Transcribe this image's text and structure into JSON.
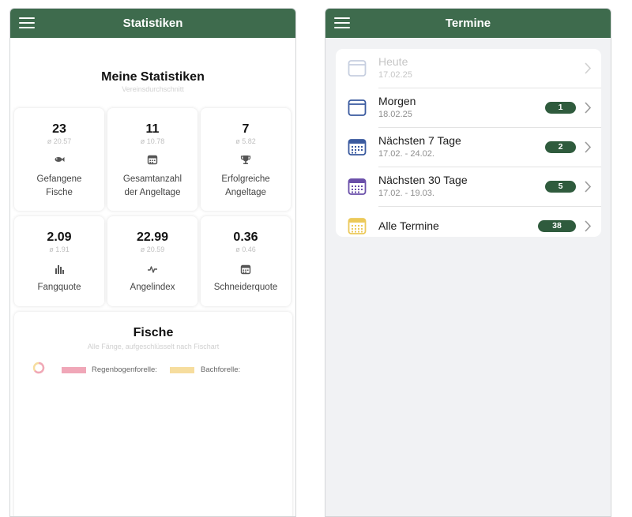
{
  "statistics_screen": {
    "app_bar_title": "Statistiken",
    "heading": "Meine Statistiken",
    "subheading": "Vereinsdurchschnitt",
    "stats": [
      {
        "value": "23",
        "average": "ø 20.57",
        "label_line1": "Gefangene",
        "label_line2": "Fische",
        "icon": "fish-icon"
      },
      {
        "value": "11",
        "average": "ø 10.78",
        "label_line1": "Gesamtanzahl",
        "label_line2": "der Angeltage",
        "icon": "calendar-icon"
      },
      {
        "value": "7",
        "average": "ø 5.82",
        "label_line1": "Erfolgreiche",
        "label_line2": "Angeltage",
        "icon": "trophy-icon"
      },
      {
        "value": "2.09",
        "average": "ø 1.91",
        "label_line1": "Fangquote",
        "icon": "bar-chart-icon"
      },
      {
        "value": "22.99",
        "average": "ø 20.59",
        "label_line1": "Angelindex",
        "icon": "pulse-icon"
      },
      {
        "value": "0.36",
        "average": "ø 0.46",
        "label_line1": "Schneiderquote",
        "icon": "calendar-icon"
      }
    ],
    "fish_section": {
      "title": "Fische",
      "subtitle": "Alle Fänge, aufgeschlüsselt nach Fischart",
      "legend": [
        {
          "label": "Regenbogenforelle:",
          "color": "#f0a7b8"
        },
        {
          "label": "Bachforelle:",
          "color": "#f6dd9e"
        }
      ]
    }
  },
  "termine_screen": {
    "app_bar_title": "Termine",
    "rows": [
      {
        "title": "Heute",
        "date": "17.02.25",
        "count": "",
        "icon_color": "#c7cfe0",
        "disabled": true
      },
      {
        "title": "Morgen",
        "date": "18.02.25",
        "count": "1",
        "icon_color": "#3a5a9f"
      },
      {
        "title": "Nächsten 7 Tage",
        "date": "17.02. - 24.02.",
        "count": "2",
        "icon_color": "#3a5a9f"
      },
      {
        "title": "Nächsten 30 Tage",
        "date": "17.02. - 19.03.",
        "count": "5",
        "icon_color": "#6a4fa9"
      },
      {
        "title": "Alle Termine",
        "date": "",
        "count": "38",
        "icon_color": "#ecc95a"
      }
    ]
  },
  "colors": {
    "app_bar": "#3e6b4d",
    "badge": "#2f5b3d"
  }
}
